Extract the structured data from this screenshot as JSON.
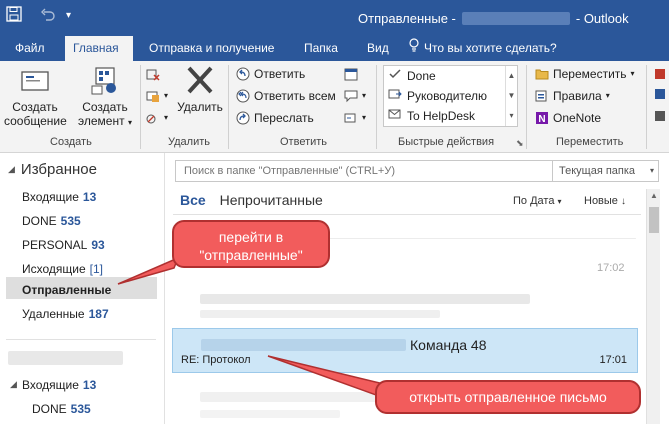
{
  "window": {
    "title_prefix": "Отправленные -",
    "title_suffix": "- Outlook"
  },
  "tabs": [
    {
      "label": "Файл"
    },
    {
      "label": "Главная"
    },
    {
      "label": "Отправка и получение"
    },
    {
      "label": "Папка"
    },
    {
      "label": "Вид"
    }
  ],
  "tell_me": "Что вы хотите сделать?",
  "ribbon": {
    "create": {
      "new_message_l1": "Создать",
      "new_message_l2": "сообщение",
      "new_item_l1": "Создать",
      "new_item_l2": "элемент",
      "group_label": "Создать"
    },
    "delete": {
      "delete_label": "Удалить",
      "group_label": "Удалить"
    },
    "respond": {
      "reply": "Ответить",
      "reply_all": "Ответить всем",
      "forward": "Переслать",
      "group_label": "Ответить"
    },
    "quick_steps": {
      "items": [
        "Done",
        "Руководителю",
        "To HelpDesk"
      ],
      "group_label": "Быстрые действия"
    },
    "move": {
      "move": "Переместить",
      "rules": "Правила",
      "onenote": "OneNote",
      "group_label": "Переместить"
    }
  },
  "left_pane": {
    "favorites_header": "Избранное",
    "folders": [
      {
        "name": "Входящие",
        "count": "13"
      },
      {
        "name": "DONE",
        "count": "535"
      },
      {
        "name": "PERSONAL",
        "count": "93"
      },
      {
        "name": "Исходящие",
        "count": "[1]"
      },
      {
        "name": "Отправленные",
        "count": ""
      },
      {
        "name": "Удаленные",
        "count": "187"
      }
    ],
    "account_folders": [
      {
        "name": "Входящие",
        "count": "13"
      },
      {
        "name": "DONE",
        "count": "535"
      }
    ]
  },
  "search": {
    "placeholder": "Поиск в папке \"Отправленные\" (CTRL+У)",
    "scope": "Текущая папка"
  },
  "filters": {
    "all": "Все",
    "unread": "Непрочитанные",
    "sort_by": "По Дата",
    "order": "Новые"
  },
  "messages": [
    {
      "time": "17:02"
    },
    {
      "sender_suffix": "Команда 48",
      "subject": "RE: Протокол",
      "time": "17:01"
    }
  ],
  "annotations": {
    "go_to_sent": "перейти в \"отправленные\"",
    "open_sent": "открыть отправленное письмо"
  },
  "colors": {
    "brand": "#2b579a",
    "selected_row": "#cde6f7",
    "callout": "#f25c5c"
  }
}
